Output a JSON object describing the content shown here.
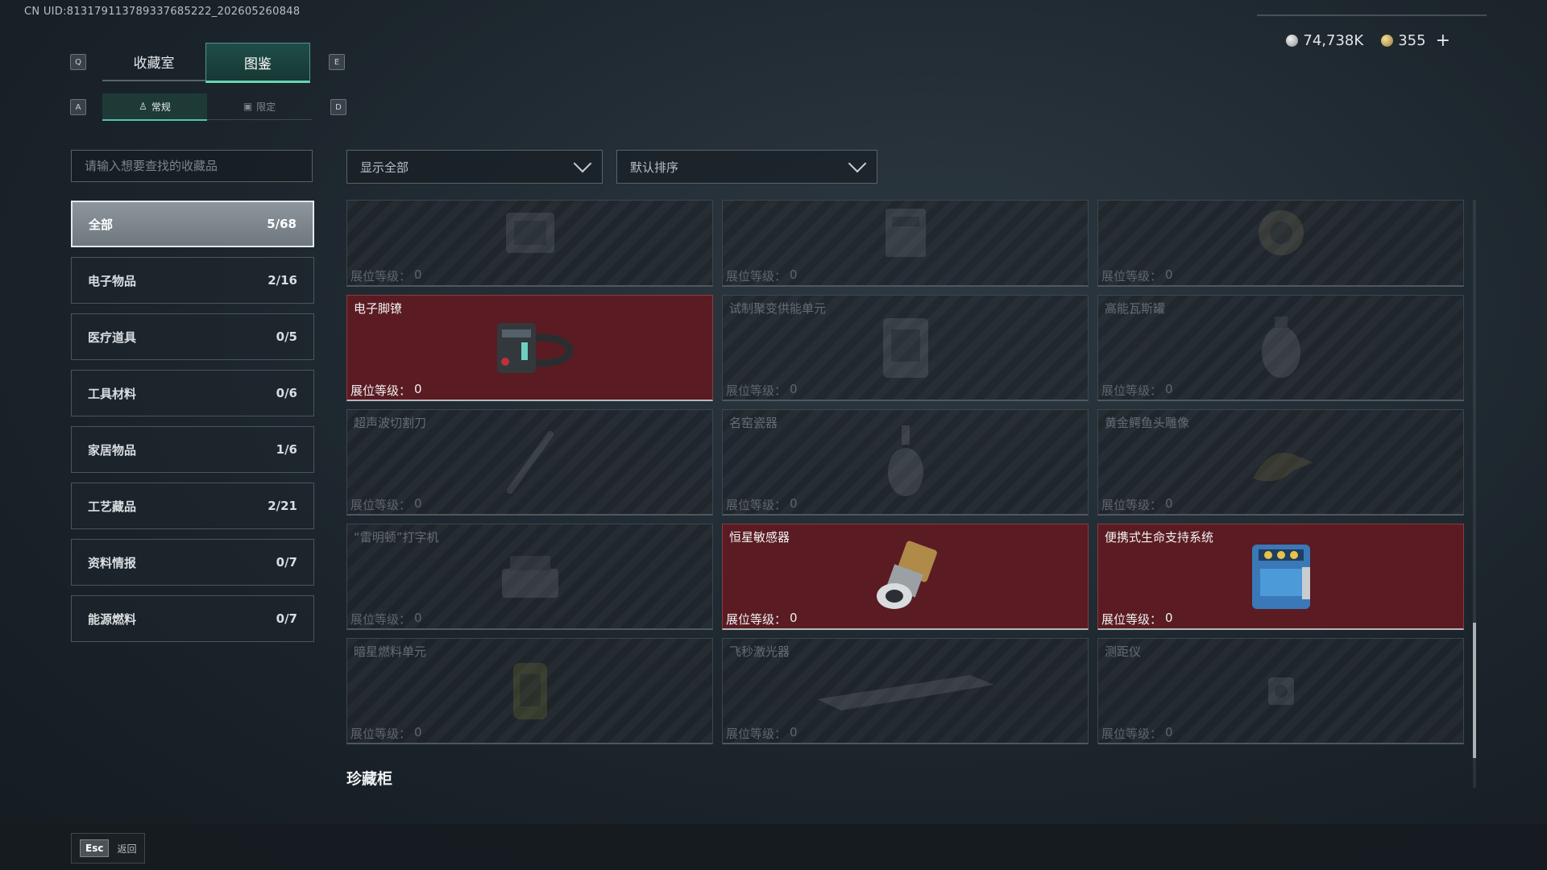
{
  "uid": "CN UID:813179113789337685222_202605260848",
  "currency": {
    "silver": "74,738K",
    "gold": "355",
    "add": "+"
  },
  "keys": {
    "q": "Q",
    "e": "E",
    "a": "A",
    "d": "D"
  },
  "tabs": [
    {
      "label": "收藏室"
    },
    {
      "label": "图鉴"
    }
  ],
  "subtabs": [
    {
      "label": "常规"
    },
    {
      "label": "限定"
    }
  ],
  "search": {
    "placeholder": "请输入想要查找的收藏品"
  },
  "filters": {
    "show": "显示全部",
    "sort": "默认排序"
  },
  "categories": [
    {
      "name": "全部",
      "count": "5/68"
    },
    {
      "name": "电子物品",
      "count": "2/16"
    },
    {
      "name": "医疗道具",
      "count": "0/5"
    },
    {
      "name": "工具材料",
      "count": "0/6"
    },
    {
      "name": "家居物品",
      "count": "1/6"
    },
    {
      "name": "工艺藏品",
      "count": "2/21"
    },
    {
      "name": "资料情报",
      "count": "0/7"
    },
    {
      "name": "能源燃料",
      "count": "0/7"
    }
  ],
  "level_label": "展位等级：",
  "items": [
    {
      "name": "",
      "level": "0",
      "owned": false,
      "icon": "module-icon"
    },
    {
      "name": "",
      "level": "0",
      "owned": false,
      "icon": "device-icon"
    },
    {
      "name": "",
      "level": "0",
      "owned": false,
      "icon": "helmet-icon"
    },
    {
      "name": "电子脚镣",
      "level": "0",
      "owned": true,
      "icon": "ankle-monitor-icon"
    },
    {
      "name": "试制聚变供能单元",
      "level": "0",
      "owned": false,
      "icon": "fusion-unit-icon"
    },
    {
      "name": "高能瓦斯罐",
      "level": "0",
      "owned": false,
      "icon": "gas-tank-icon"
    },
    {
      "name": "超声波切割刀",
      "level": "0",
      "owned": false,
      "icon": "blade-icon"
    },
    {
      "name": "名窑瓷器",
      "level": "0",
      "owned": false,
      "icon": "porcelain-icon"
    },
    {
      "name": "黄金鳄鱼头雕像",
      "level": "0",
      "owned": false,
      "icon": "statue-icon"
    },
    {
      "name": "“雷明顿”打字机",
      "level": "0",
      "owned": false,
      "icon": "typewriter-icon"
    },
    {
      "name": "恒星敏感器",
      "level": "0",
      "owned": true,
      "icon": "star-sensor-icon"
    },
    {
      "name": "便携式生命支持系统",
      "level": "0",
      "owned": true,
      "icon": "life-support-icon"
    },
    {
      "name": "暗星燃料单元",
      "level": "0",
      "owned": false,
      "icon": "fuel-cell-icon"
    },
    {
      "name": "飞秒激光器",
      "level": "0",
      "owned": false,
      "icon": "laser-icon"
    },
    {
      "name": "测距仪",
      "level": "0",
      "owned": false,
      "icon": "rangefinder-icon"
    }
  ],
  "section_title": "珍藏柜",
  "back": {
    "key": "Esc",
    "label": "返回"
  }
}
